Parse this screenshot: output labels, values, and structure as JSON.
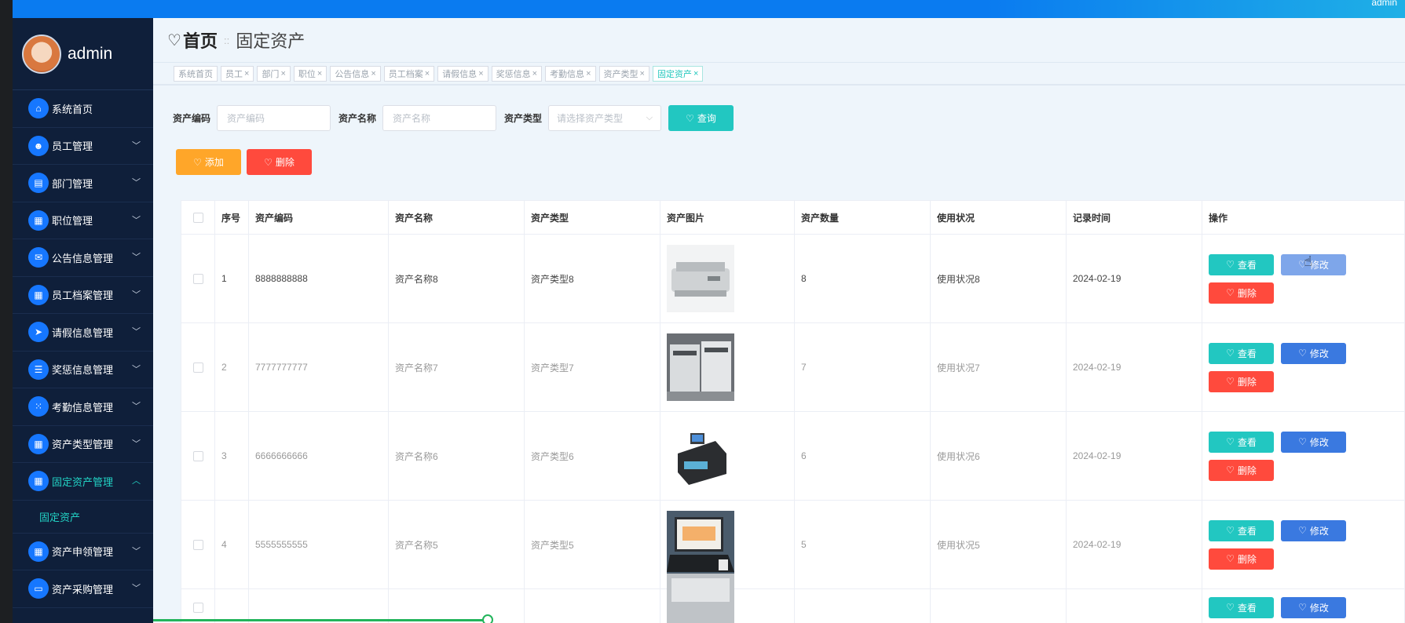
{
  "topbar": {
    "user": "admin"
  },
  "sidebar": {
    "username": "admin",
    "items": [
      {
        "label": "系统首页",
        "icon": "home-icon",
        "glyph": "⌂",
        "chevron": false
      },
      {
        "label": "员工管理",
        "icon": "user-icon",
        "glyph": "☻",
        "chevron": true
      },
      {
        "label": "部门管理",
        "icon": "clipboard-icon",
        "glyph": "▤",
        "chevron": true
      },
      {
        "label": "职位管理",
        "icon": "grid-icon",
        "glyph": "▦",
        "chevron": true
      },
      {
        "label": "公告信息管理",
        "icon": "ticket-icon",
        "glyph": "✉",
        "chevron": true
      },
      {
        "label": "员工档案管理",
        "icon": "grid-icon",
        "glyph": "▦",
        "chevron": true
      },
      {
        "label": "请假信息管理",
        "icon": "send-icon",
        "glyph": "➤",
        "chevron": true
      },
      {
        "label": "奖惩信息管理",
        "icon": "list-icon",
        "glyph": "☰",
        "chevron": true
      },
      {
        "label": "考勤信息管理",
        "icon": "apps-icon",
        "glyph": "⁙",
        "chevron": true
      },
      {
        "label": "资产类型管理",
        "icon": "grid-icon",
        "glyph": "▦",
        "chevron": true
      },
      {
        "label": "固定资产管理",
        "icon": "grid-icon",
        "glyph": "▦",
        "chevron": true,
        "active": true
      },
      {
        "label": "资产申领管理",
        "icon": "grid-icon",
        "glyph": "▦",
        "chevron": true
      },
      {
        "label": "资产采购管理",
        "icon": "monitor-icon",
        "glyph": "▭",
        "chevron": true
      }
    ],
    "sub_item": "固定资产"
  },
  "breadcrumb": {
    "home": "首页",
    "sep": "::",
    "current": "固定资产"
  },
  "tags": [
    {
      "label": "系统首页",
      "close": false
    },
    {
      "label": "员工",
      "close": true
    },
    {
      "label": "部门",
      "close": true
    },
    {
      "label": "职位",
      "close": true
    },
    {
      "label": "公告信息",
      "close": true
    },
    {
      "label": "员工档案",
      "close": true
    },
    {
      "label": "请假信息",
      "close": true
    },
    {
      "label": "奖惩信息",
      "close": true
    },
    {
      "label": "考勤信息",
      "close": true
    },
    {
      "label": "资产类型",
      "close": true
    },
    {
      "label": "固定资产",
      "close": true,
      "active": true
    }
  ],
  "search": {
    "code_label": "资产编码",
    "code_placeholder": "资产编码",
    "name_label": "资产名称",
    "name_placeholder": "资产名称",
    "type_label": "资产类型",
    "type_placeholder": "请选择资产类型",
    "query_btn": "查询"
  },
  "actions": {
    "add": "添加",
    "delete": "删除"
  },
  "table": {
    "headers": [
      "序号",
      "资产编码",
      "资产名称",
      "资产类型",
      "资产图片",
      "资产数量",
      "使用状况",
      "记录时间",
      "操作"
    ],
    "rows": [
      {
        "no": "1",
        "code": "8888888888",
        "name": "资产名称8",
        "type": "资产类型8",
        "image": "printer-image",
        "qty": "8",
        "status": "使用状况8",
        "time": "2024-02-19"
      },
      {
        "no": "2",
        "code": "7777777777",
        "name": "资产名称7",
        "type": "资产类型7",
        "image": "copier-image",
        "qty": "7",
        "status": "使用状况7",
        "time": "2024-02-19"
      },
      {
        "no": "3",
        "code": "6666666666",
        "name": "资产名称6",
        "type": "资产类型6",
        "image": "money-counter-image",
        "qty": "6",
        "status": "使用状况6",
        "time": "2024-02-19"
      },
      {
        "no": "4",
        "code": "5555555555",
        "name": "资产名称5",
        "type": "资产类型5",
        "image": "laptop-image",
        "qty": "5",
        "status": "使用状况5",
        "time": "2024-02-19"
      },
      {
        "no": "",
        "code": "",
        "name": "",
        "type": "",
        "image": "device-image",
        "qty": "",
        "status": "",
        "time": ""
      }
    ],
    "op_view": "查看",
    "op_edit": "修改",
    "op_delete": "删除"
  },
  "colors": {
    "sidebar_bg": "#0f1f3a",
    "accent_teal": "#22c7c1",
    "accent_blue": "#3a79e0",
    "accent_red": "#ff4a3d",
    "accent_orange": "#ffa629",
    "topbar": "#0a7bf0"
  }
}
